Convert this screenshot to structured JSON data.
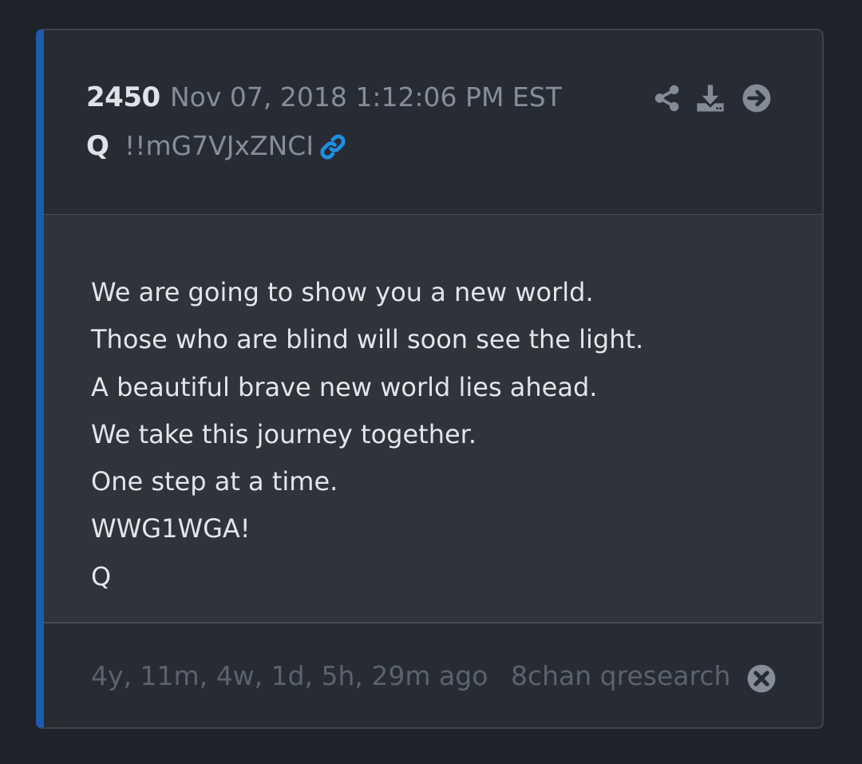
{
  "post": {
    "number": "2450",
    "date": "Nov 07, 2018 1:12:06 PM EST",
    "author": "Q",
    "tripcode": "!!mG7VJxZNCI",
    "lines": [
      "We are going to show you a new world.",
      "Those who are blind will soon see the light.",
      "A beautiful brave new world lies ahead.",
      "We take this journey together.",
      "One step at a time.",
      "WWG1WGA!",
      "Q"
    ],
    "elapsed": "4y, 11m, 4w, 1d, 5h, 29m ago",
    "source": "8chan qresearch"
  },
  "icons": {
    "header_link": "link-icon",
    "actions": [
      "share-icon",
      "download-icon",
      "arrow-right-circle-icon"
    ],
    "footer": "close-circle-icon"
  },
  "colors": {
    "accent_bar": "#1c5bad",
    "link": "#1f8fe0",
    "background": "#1f2229",
    "card": "#272b33",
    "body": "#2e333c"
  }
}
